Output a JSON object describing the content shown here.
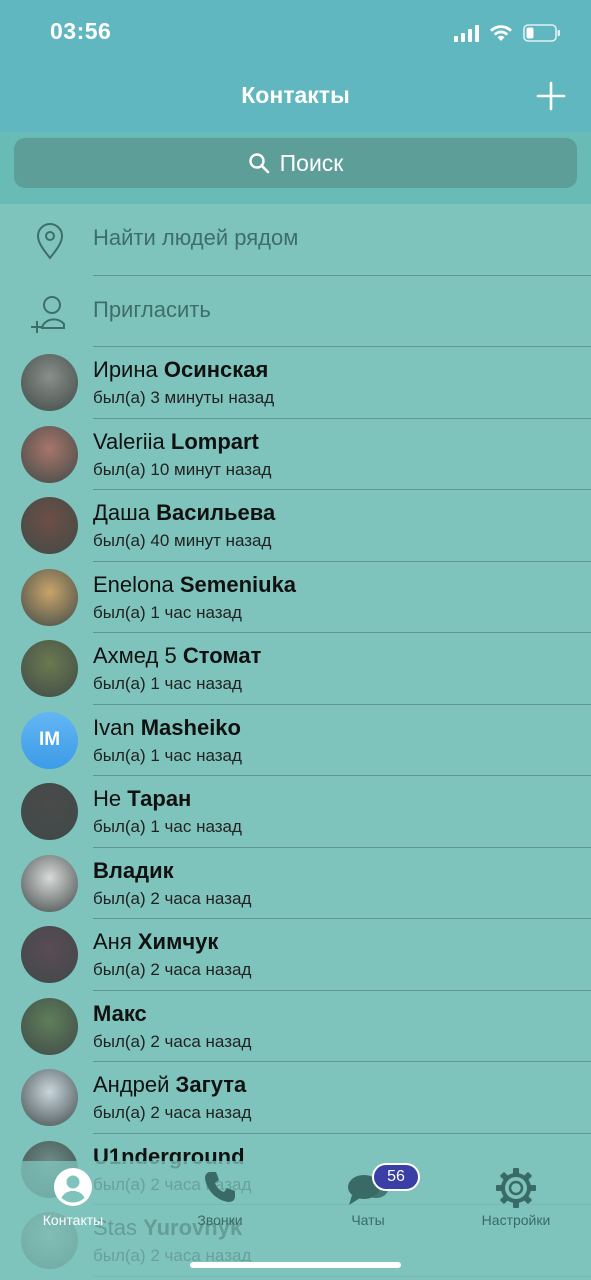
{
  "status_bar": {
    "time": "03:56"
  },
  "header": {
    "title": "Контакты"
  },
  "search": {
    "label": "Поиск"
  },
  "actions": [
    {
      "label": "Найти людей рядом",
      "icon": "location-pin-icon"
    },
    {
      "label": "Пригласить",
      "icon": "add-person-icon"
    }
  ],
  "contacts": [
    {
      "first": "Ирина",
      "last": "Осинская",
      "status": "был(а) 3 минуты назад",
      "avatar_color": "#8a8f8a"
    },
    {
      "first": "Valeriia",
      "last": "Lompart",
      "status": "был(а) 10 минут назад",
      "avatar_color": "#a8756a"
    },
    {
      "first": "Даша",
      "last": "Васильева",
      "status": "был(а) 40 минут назад",
      "avatar_color": "#6e4f45"
    },
    {
      "first": "Enelona",
      "last": "Semeniuka",
      "status": "был(а) 1 час назад",
      "avatar_color": "#c9a46a"
    },
    {
      "first": "Ахмед 5",
      "last": "Стомат",
      "status": "был(а) 1 час назад",
      "avatar_color": "#6b7a4f"
    },
    {
      "first": "Ivan",
      "last": "Masheiko",
      "status": "был(а) 1 час назад",
      "initials": "IM",
      "avatar_color": "#3d9be8"
    },
    {
      "first": "Не",
      "last": "Таран",
      "status": "был(а) 1 час назад",
      "avatar_color": "#4a4a4a"
    },
    {
      "first": "",
      "last": "Владик",
      "status": "был(а) 2 часа назад",
      "avatar_color": "#d9d9d9"
    },
    {
      "first": "Аня",
      "last": "Химчук",
      "status": "был(а) 2 часа назад",
      "avatar_color": "#5a4b55"
    },
    {
      "first": "",
      "last": "Макс",
      "status": "был(а) 2 часа назад",
      "avatar_color": "#5f7e5a"
    },
    {
      "first": "Андрей",
      "last": "Загута",
      "status": "был(а) 2 часа назад",
      "avatar_color": "#c9d6dd"
    },
    {
      "first": "",
      "last": "U1nderground",
      "status": "был(а) 2 часа назад",
      "avatar_color": "#6f8f8a"
    },
    {
      "first": "Stas",
      "last": "Yurovnyk",
      "status": "был(а) 2 часа назад",
      "avatar_color": "#8fa6a0"
    }
  ],
  "tabs": [
    {
      "label": "Контакты",
      "icon": "contacts-icon",
      "active": true
    },
    {
      "label": "Звонки",
      "icon": "phone-icon",
      "active": false
    },
    {
      "label": "Чаты",
      "icon": "chat-bubbles-icon",
      "active": false,
      "badge": "56"
    },
    {
      "label": "Настройки",
      "icon": "gear-icon",
      "active": false
    }
  ]
}
